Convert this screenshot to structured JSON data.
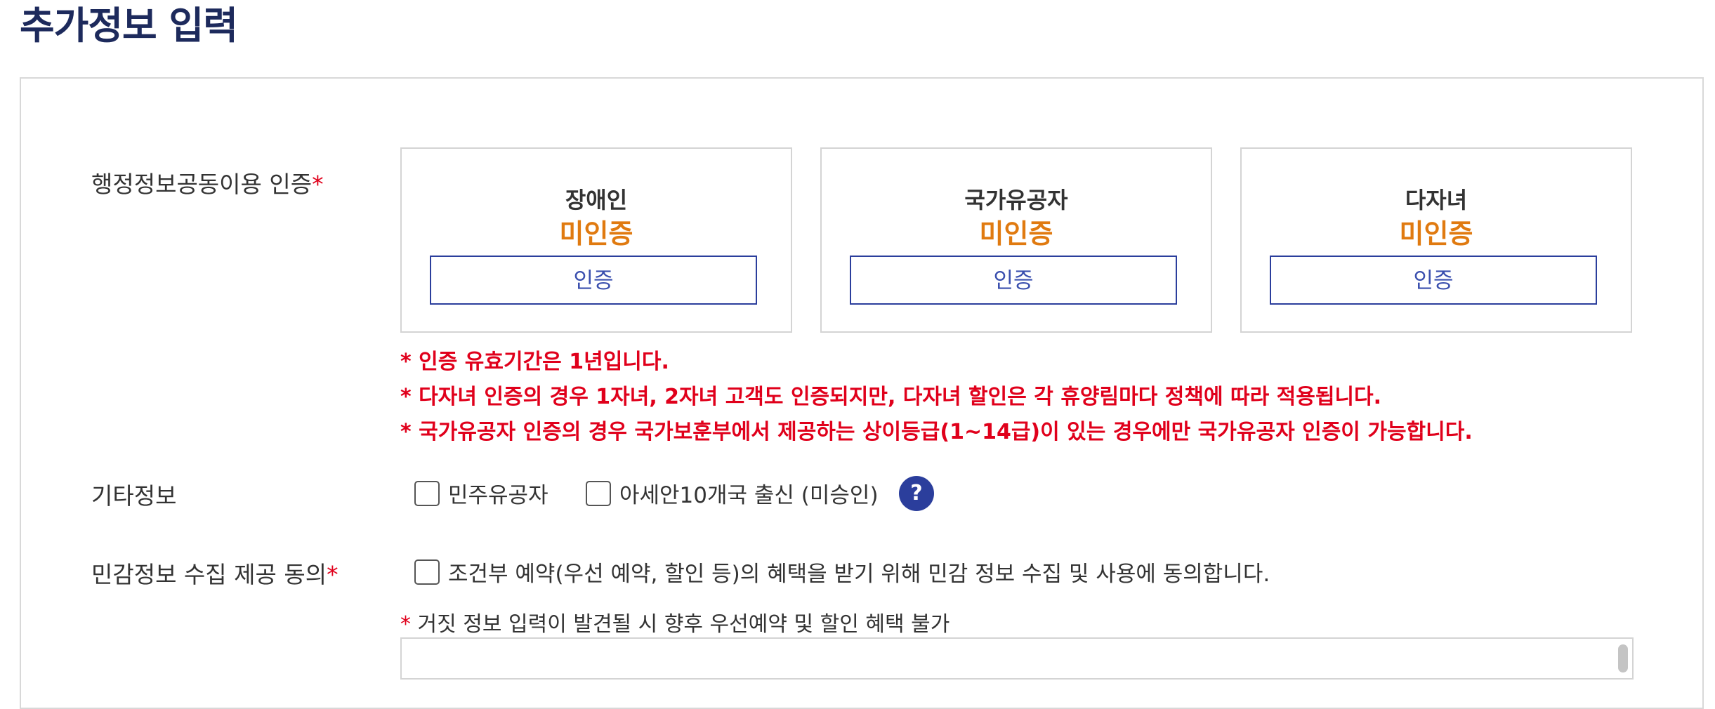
{
  "page": {
    "title": "추가정보 입력"
  },
  "admin_cert": {
    "label": "행정정보공동이용 인증",
    "required_mark": "*",
    "items": [
      {
        "name": "장애인",
        "status": "미인증",
        "button": "인증"
      },
      {
        "name": "국가유공자",
        "status": "미인증",
        "button": "인증"
      },
      {
        "name": "다자녀",
        "status": "미인증",
        "button": "인증"
      }
    ],
    "notices": [
      "* 인증 유효기간은 1년입니다.",
      "* 다자녀 인증의 경우 1자녀, 2자녀 고객도 인증되지만, 다자녀 할인은 각 휴양림마다 정책에 따라 적용됩니다.",
      "* 국가유공자 인증의 경우 국가보훈부에서 제공하는 상이등급(1~14급)이 있는 경우에만 국가유공자 인증이 가능합니다."
    ]
  },
  "other_info": {
    "label": "기타정보",
    "options": [
      "민주유공자",
      "아세안10개국 출신 (미승인)"
    ],
    "help": "?"
  },
  "sensitive": {
    "label": "민감정보 수집 제공 동의",
    "required_mark": "*",
    "agree_text": "조건부 예약(우선 예약, 할인 등)의 혜택을 받기 위해 민감 정보 수집 및 사용에 동의합니다.",
    "warning_star": "*",
    "warning": " 거짓 정보 입력이 발견될 시 향후 우선예약 및 할인 혜택 불가"
  },
  "colors": {
    "title": "#1d2a5c",
    "required": "#e0001b",
    "status": "#e07a10",
    "button_border": "#2b3e9c"
  }
}
